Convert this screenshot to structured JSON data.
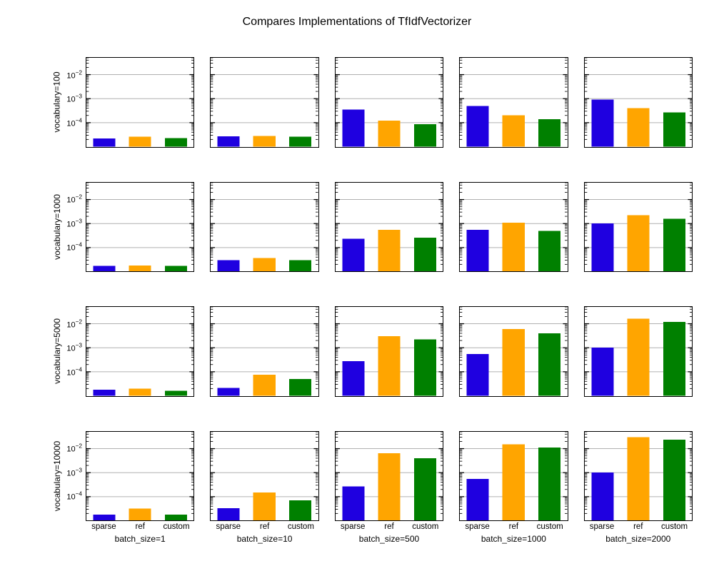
{
  "title": "Compares Implementations of TfIdfVectorizer",
  "categories": [
    "sparse",
    "ref",
    "custom"
  ],
  "colors": [
    "#1f00e0",
    "#ffa500",
    "#008000"
  ],
  "rows": [
    {
      "ylabel": "vocabulary=100"
    },
    {
      "ylabel": "vocabulary=1000"
    },
    {
      "ylabel": "vocabulary=5000"
    },
    {
      "ylabel": "vocabulary=10000"
    }
  ],
  "cols": [
    {
      "xlabel": "batch_size=1"
    },
    {
      "xlabel": "batch_size=10"
    },
    {
      "xlabel": "batch_size=500"
    },
    {
      "xlabel": "batch_size=1000"
    },
    {
      "xlabel": "batch_size=2000"
    }
  ],
  "y_axis": {
    "min_exp": -5,
    "max_exp": -1.3,
    "major_ticks_exp": [
      -4,
      -3,
      -2
    ],
    "tick_labels": [
      "10⁻⁴",
      "10⁻³",
      "10⁻²"
    ]
  },
  "chart_data": [
    {
      "type": "bar",
      "row": 0,
      "col": 0,
      "categories": [
        "sparse",
        "ref",
        "custom"
      ],
      "values": [
        2.2e-05,
        2.6e-05,
        2.3e-05
      ]
    },
    {
      "type": "bar",
      "row": 0,
      "col": 1,
      "categories": [
        "sparse",
        "ref",
        "custom"
      ],
      "values": [
        2.7e-05,
        2.8e-05,
        2.6e-05
      ]
    },
    {
      "type": "bar",
      "row": 0,
      "col": 2,
      "categories": [
        "sparse",
        "ref",
        "custom"
      ],
      "values": [
        0.00035,
        0.00012,
        8.5e-05
      ]
    },
    {
      "type": "bar",
      "row": 0,
      "col": 3,
      "categories": [
        "sparse",
        "ref",
        "custom"
      ],
      "values": [
        0.0005,
        0.0002,
        0.00014
      ]
    },
    {
      "type": "bar",
      "row": 0,
      "col": 4,
      "categories": [
        "sparse",
        "ref",
        "custom"
      ],
      "values": [
        0.0009,
        0.0004,
        0.00027
      ]
    },
    {
      "type": "bar",
      "row": 1,
      "col": 0,
      "categories": [
        "sparse",
        "ref",
        "custom"
      ],
      "values": [
        1.7e-05,
        1.8e-05,
        1.7e-05
      ]
    },
    {
      "type": "bar",
      "row": 1,
      "col": 1,
      "categories": [
        "sparse",
        "ref",
        "custom"
      ],
      "values": [
        3e-05,
        3.7e-05,
        3e-05
      ]
    },
    {
      "type": "bar",
      "row": 1,
      "col": 2,
      "categories": [
        "sparse",
        "ref",
        "custom"
      ],
      "values": [
        0.00023,
        0.00055,
        0.00026
      ]
    },
    {
      "type": "bar",
      "row": 1,
      "col": 3,
      "categories": [
        "sparse",
        "ref",
        "custom"
      ],
      "values": [
        0.00055,
        0.0011,
        0.0005
      ]
    },
    {
      "type": "bar",
      "row": 1,
      "col": 4,
      "categories": [
        "sparse",
        "ref",
        "custom"
      ],
      "values": [
        0.001,
        0.0022,
        0.0016
      ]
    },
    {
      "type": "bar",
      "row": 2,
      "col": 0,
      "categories": [
        "sparse",
        "ref",
        "custom"
      ],
      "values": [
        1.8e-05,
        2e-05,
        1.6e-05
      ]
    },
    {
      "type": "bar",
      "row": 2,
      "col": 1,
      "categories": [
        "sparse",
        "ref",
        "custom"
      ],
      "values": [
        2.1e-05,
        7.5e-05,
        5e-05
      ]
    },
    {
      "type": "bar",
      "row": 2,
      "col": 2,
      "categories": [
        "sparse",
        "ref",
        "custom"
      ],
      "values": [
        0.00028,
        0.003,
        0.0022
      ]
    },
    {
      "type": "bar",
      "row": 2,
      "col": 3,
      "categories": [
        "sparse",
        "ref",
        "custom"
      ],
      "values": [
        0.00055,
        0.006,
        0.004
      ]
    },
    {
      "type": "bar",
      "row": 2,
      "col": 4,
      "categories": [
        "sparse",
        "ref",
        "custom"
      ],
      "values": [
        0.001,
        0.016,
        0.012
      ]
    },
    {
      "type": "bar",
      "row": 3,
      "col": 0,
      "categories": [
        "sparse",
        "ref",
        "custom"
      ],
      "values": [
        1.8e-05,
        3.2e-05,
        1.8e-05
      ]
    },
    {
      "type": "bar",
      "row": 3,
      "col": 1,
      "categories": [
        "sparse",
        "ref",
        "custom"
      ],
      "values": [
        3.3e-05,
        0.00015,
        7e-05
      ]
    },
    {
      "type": "bar",
      "row": 3,
      "col": 2,
      "categories": [
        "sparse",
        "ref",
        "custom"
      ],
      "values": [
        0.00027,
        0.0065,
        0.004
      ]
    },
    {
      "type": "bar",
      "row": 3,
      "col": 3,
      "categories": [
        "sparse",
        "ref",
        "custom"
      ],
      "values": [
        0.00055,
        0.015,
        0.011
      ]
    },
    {
      "type": "bar",
      "row": 3,
      "col": 4,
      "categories": [
        "sparse",
        "ref",
        "custom"
      ],
      "values": [
        0.001,
        0.03,
        0.024
      ]
    }
  ]
}
